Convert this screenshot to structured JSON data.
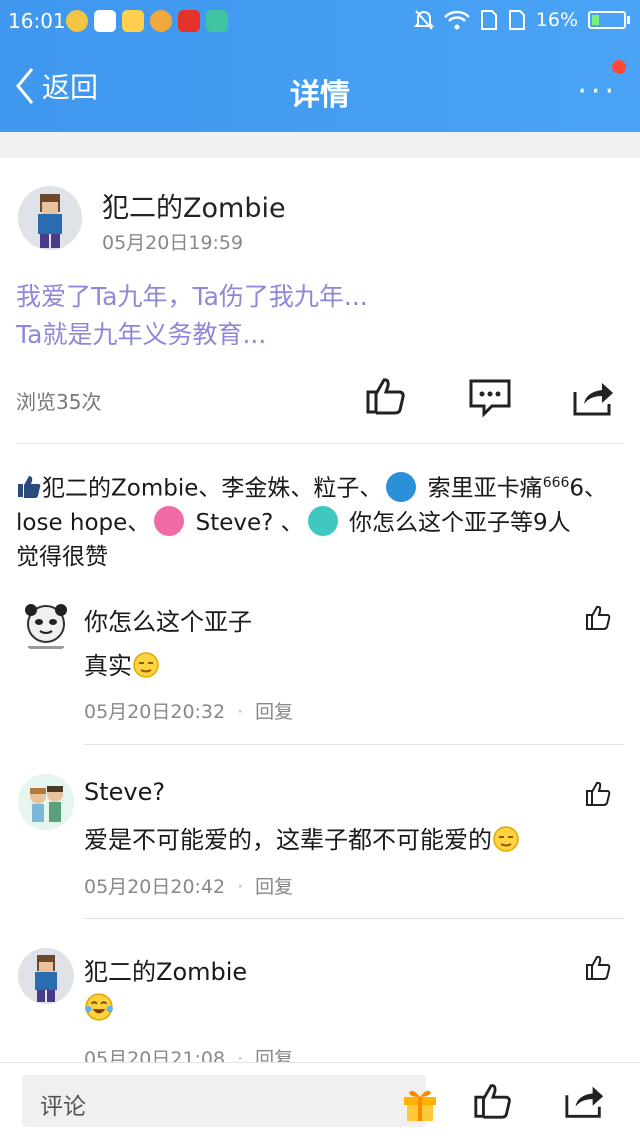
{
  "status_bar": {
    "time": "16:01",
    "battery": "16%",
    "app_colors": [
      "#f4c542",
      "#ffffff",
      "#ffd050",
      "#f2a93b",
      "#e5322b",
      "#3fc3a0"
    ]
  },
  "navbar": {
    "back_label": "返回",
    "title": "详情",
    "more_label": "···"
  },
  "post": {
    "author": "犯二的Zombie",
    "time": "05月20日19:59",
    "body_line1": "我爱了Ta九年，Ta伤了我九年...",
    "body_line2": "Ta就是九年义务教育...",
    "views": "浏览35次"
  },
  "likes": {
    "part1": "犯二的Zombie、李金姝、粒子、",
    "part2": " 索里亚卡痛",
    "part2_sup": "666",
    "part3": "6、lose hope、",
    "part4": " Steve? 、",
    "part5": " 你怎么这个亚子等9人",
    "part6": "觉得很赞"
  },
  "comments": [
    {
      "name": "你怎么这个亚子",
      "text": "真实",
      "time": "05月20日20:32",
      "reply": "回复"
    },
    {
      "name": "Steve?",
      "text": "爱是不可能爱的，这辈子都不可能爱的",
      "time": "05月20日20:42",
      "reply": "回复"
    },
    {
      "name": "犯二的Zombie",
      "text": "",
      "time": "05月20日21:08",
      "reply": "回复"
    }
  ],
  "bottom_bar": {
    "comment_placeholder": "评论"
  }
}
